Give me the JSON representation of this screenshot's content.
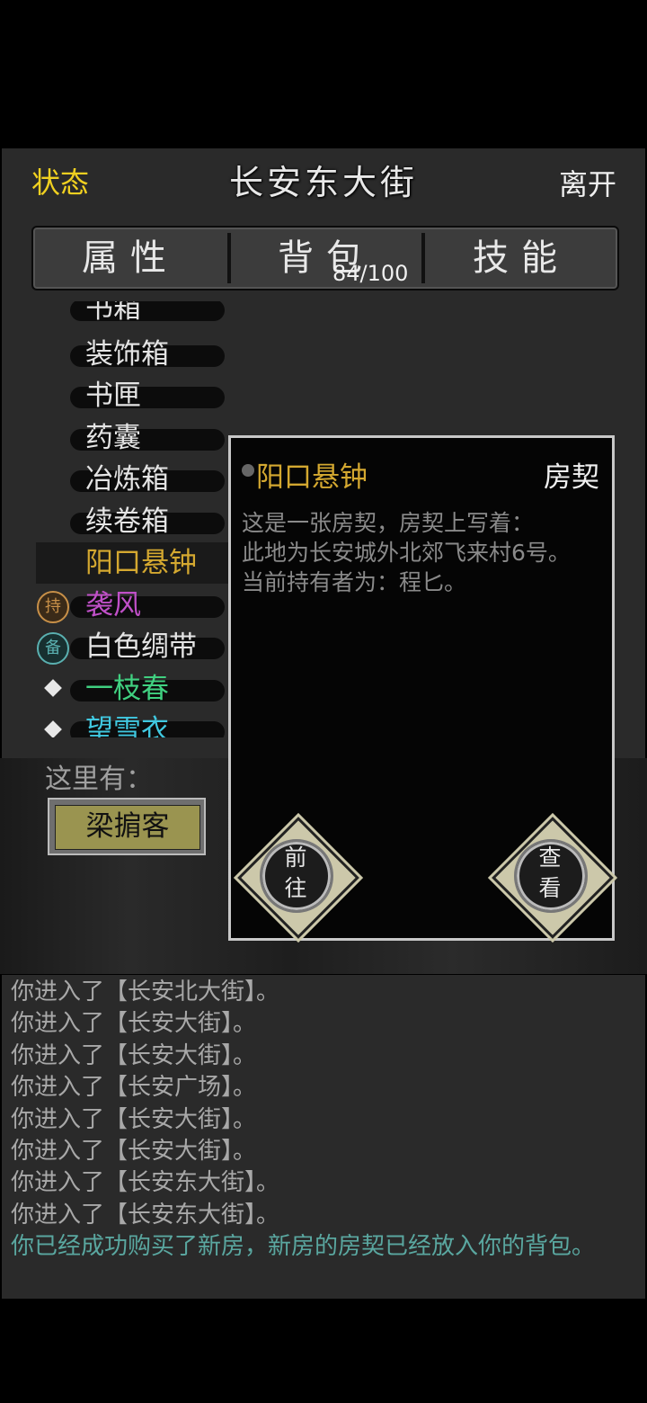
{
  "header": {
    "status": "状态",
    "title": "长安东大街",
    "leave": "离开"
  },
  "tabs": [
    {
      "label": "属性"
    },
    {
      "label": "背包",
      "count": "84/100"
    },
    {
      "label": "技能"
    }
  ],
  "items": [
    {
      "name": "书箱",
      "color": "#e4e4e4"
    },
    {
      "name": "装饰箱",
      "color": "#e4e4e4"
    },
    {
      "name": "书匣",
      "color": "#e4e4e4"
    },
    {
      "name": "药囊",
      "color": "#e4e4e4"
    },
    {
      "name": "冶炼箱",
      "color": "#e4e4e4"
    },
    {
      "name": "续卷箱",
      "color": "#e4e4e4"
    },
    {
      "name": "阳口悬钟",
      "color": "#d4a830",
      "selected": true
    },
    {
      "name": "袭风",
      "color": "#c050c8",
      "badge": "持",
      "badge_color": "#c89048"
    },
    {
      "name": "白色绸带",
      "color": "#e8e8e8",
      "badge": "备",
      "badge_color": "#5ab0b0"
    },
    {
      "name": "一枝春",
      "color": "#40d080",
      "marker": "diamond"
    },
    {
      "name": "望雪衣",
      "color": "#40c8e0",
      "marker": "diamond"
    }
  ],
  "here": {
    "label": "这里有：",
    "npc": "梁掮客"
  },
  "detail": {
    "name": "阳口悬钟",
    "type": "房契",
    "description": [
      "这是一张房契，房契上写着：",
      "此地为长安城外北郊飞来村6号。",
      "当前持有者为：程匕。"
    ],
    "buttons": {
      "goto": [
        "前",
        "往"
      ],
      "view": [
        "查",
        "看"
      ]
    }
  },
  "log": [
    "你进入了【长安北大街】。",
    "你进入了【长安大街】。",
    "你进入了【长安大街】。",
    "你进入了【长安广场】。",
    "你进入了【长安大街】。",
    "你进入了【长安大街】。",
    "你进入了【长安东大街】。",
    "你进入了【长安东大街】。",
    "你已经成功购买了新房，新房的房契已经放入你的背包。"
  ]
}
